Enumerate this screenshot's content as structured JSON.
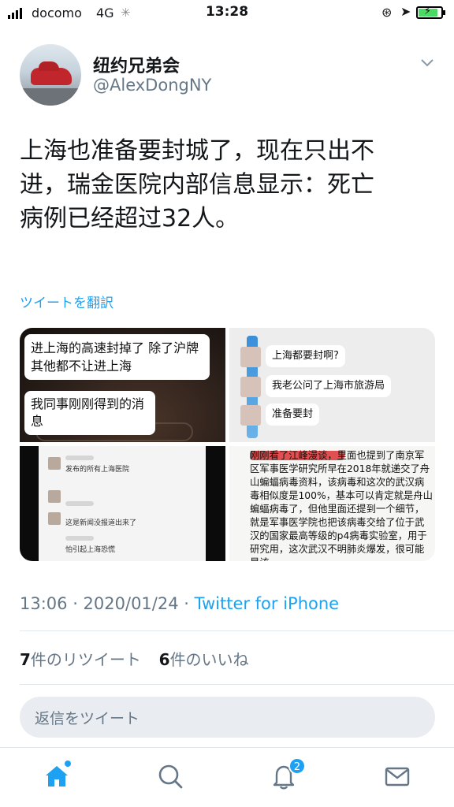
{
  "status_bar": {
    "carrier": "docomo",
    "network": "4G",
    "time": "13:28",
    "battery_level": 0.85,
    "icons": [
      "signal-icon",
      "loading-icon",
      "rotation-lock-icon",
      "location-icon",
      "battery-charging-icon"
    ]
  },
  "tweet": {
    "display_name": "纽约兄弟会",
    "handle": "@AlexDongNY",
    "text_lines": [
      "上海也准备要封城了，现在只出不",
      "进，瑞金医院内部信息显示：死亡",
      "病例已经超过32人。"
    ],
    "translate_label": "ツイートを翻訳",
    "media": {
      "tile1": {
        "msg1": "进上海的高速封掉了 除了沪牌其他都不让进上海",
        "msg2": "我同事刚刚得到的消息"
      },
      "tile2": {
        "msg1": "上海都要封啊?",
        "msg2": "我老公问了上海市旅游局",
        "msg3": "准备要封"
      },
      "tile3": {
        "line1": "发布的所有上海医院",
        "line2": "这是新闻没报道出来了",
        "line3": "怕引起上海恐慌"
      },
      "tile4": {
        "text": "刚刚看了江峰漫谈，里面也提到了南京军区军事医学研究所早在2018年就递交了舟山蝙蝠病毒资料，该病毒和这次的武汉病毒相似度是100%，基本可以肯定就是舟山蝙蝠病毒了，但他里面还提到一个细节，就是军事医学院也把该病毒交给了位于武汉的国家最高等级的p4病毒实验室，用于研究用，这次武汉不明肺炎爆发，很可能是该"
      }
    },
    "timestamp": "13:06 · 2020/01/24 · ",
    "source": "Twitter for iPhone",
    "retweet_count": "7",
    "retweet_label": "件のリツイート",
    "like_count": "6",
    "like_label": "件のいいね"
  },
  "reply": {
    "placeholder": "返信をツイート"
  },
  "tab_bar": {
    "notification_badge": "2",
    "accent": "#1da1f2"
  }
}
